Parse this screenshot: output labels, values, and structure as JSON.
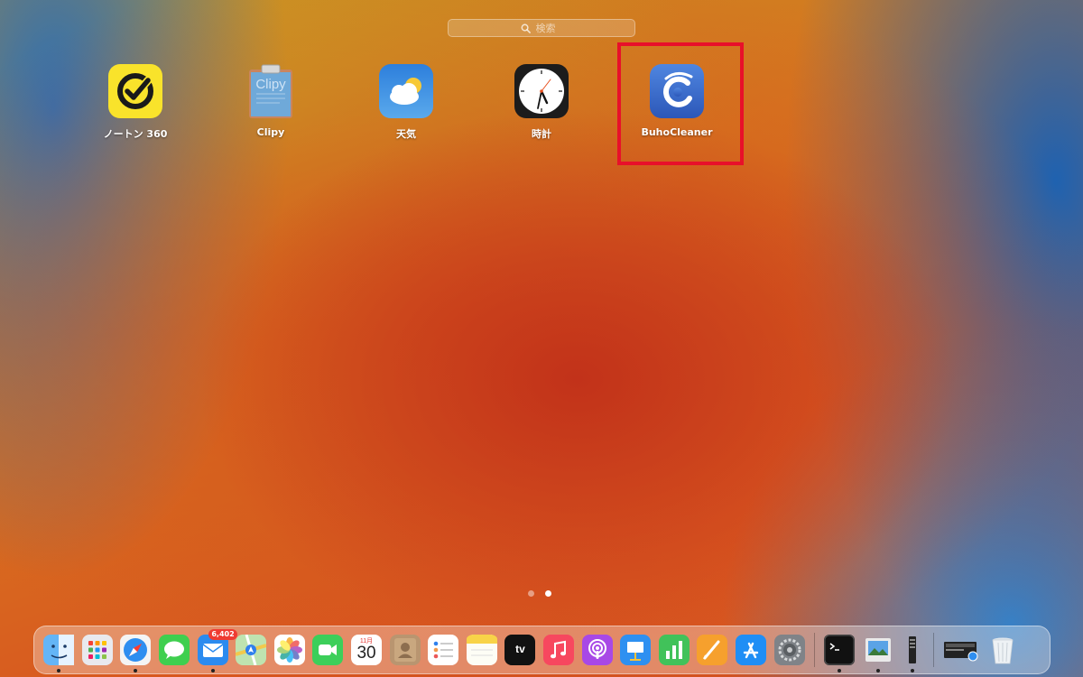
{
  "search": {
    "placeholder": "検索"
  },
  "apps": [
    {
      "name": "ノートン 360",
      "icon": "norton-icon"
    },
    {
      "name": "Clipy",
      "icon": "clipy-icon",
      "tile_text": "Clipy"
    },
    {
      "name": "天気",
      "icon": "weather-icon"
    },
    {
      "name": "時計",
      "icon": "clock-icon"
    },
    {
      "name": "BuhoCleaner",
      "icon": "buhocleaner-icon"
    }
  ],
  "highlight_color": "#e8102a",
  "pagination": {
    "pages": 2,
    "current": 2
  },
  "dock": {
    "mail_badge": "6,402",
    "calendar": {
      "month": "11月",
      "day": "30"
    },
    "tv_label": "tv",
    "items": [
      "finder-icon",
      "launchpad-icon",
      "safari-icon",
      "messages-icon",
      "mail-icon",
      "maps-icon",
      "photos-icon",
      "facetime-icon",
      "calendar-icon",
      "contacts-icon",
      "reminders-icon",
      "notes-icon",
      "apple-tv-icon",
      "music-icon",
      "podcasts-icon",
      "keynote-icon",
      "numbers-icon",
      "pages-icon",
      "app-store-icon",
      "system-preferences-icon",
      "terminal-icon",
      "preview-icon",
      "sidebar-app-icon",
      "screenshot-icon",
      "trash-icon"
    ]
  }
}
